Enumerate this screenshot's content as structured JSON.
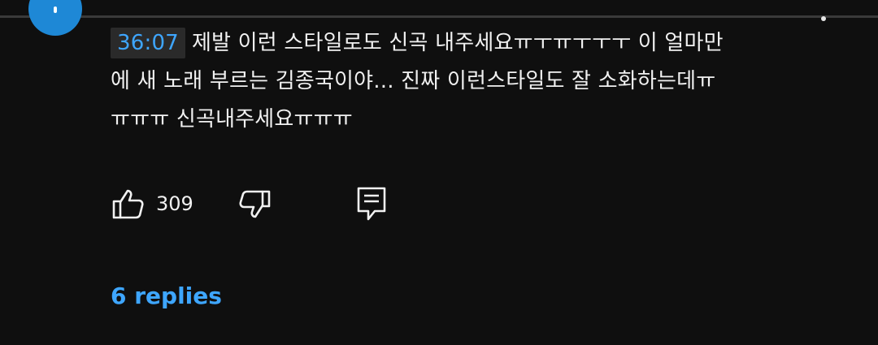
{
  "comment": {
    "timestamp": "36:07",
    "lines": [
      "제발 이런 스타일로도 신곡 내주세요ㅠㅜㅠㅜㅜㅜ 이 얼마만",
      "에 새 노래 부르는 김종국이야... 진짜 이런스타일도 잘 소화하는데ㅠ",
      "ㅠㅠㅠ 신곡내주세요ㅠㅠㅠ"
    ]
  },
  "actions": {
    "like_icon": "thumbs-up-icon",
    "like_count": "309",
    "dislike_icon": "thumbs-down-icon",
    "reply_icon": "reply-comment-icon"
  },
  "replies": {
    "label": "6 replies"
  },
  "colors": {
    "background": "#0f0f0f",
    "text": "#f1f1f1",
    "link_blue": "#3ea6ff",
    "avatar": "#1e88d6",
    "timestamp_chip": "#2a2a2a"
  },
  "icons": {
    "avatar": "avatar",
    "menu": "more-vert-icon"
  }
}
